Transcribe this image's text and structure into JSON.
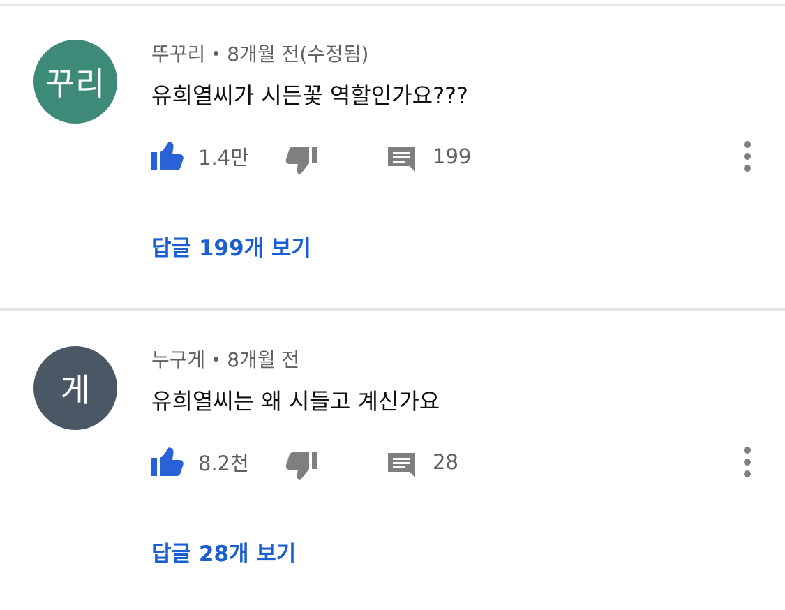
{
  "colors": {
    "like_blue": "#2962d6",
    "reply_link": "#1a5fd1",
    "meta_gray": "#606060",
    "divider": "#e5e5e5"
  },
  "comments": [
    {
      "avatar_text": "꾸리",
      "avatar_color": "#3d8a78",
      "author": "뚜꾸리",
      "time": "8개월 전(수정됨)",
      "text": "유희열씨가 시든꽃 역할인가요???",
      "likes": "1.4만",
      "reply_count": "199",
      "replies_link": "답글 199개 보기",
      "icons": [
        "thumb-up-icon",
        "thumb-down-icon",
        "comment-icon",
        "more-vert-icon"
      ]
    },
    {
      "avatar_text": "게",
      "avatar_color": "#4a5866",
      "author": "누구게",
      "time": "8개월 전",
      "text": "유희열씨는 왜 시들고 계신가요",
      "likes": "8.2천",
      "reply_count": "28",
      "replies_link": "답글 28개 보기",
      "icons": [
        "thumb-up-icon",
        "thumb-down-icon",
        "comment-icon",
        "more-vert-icon"
      ]
    }
  ]
}
